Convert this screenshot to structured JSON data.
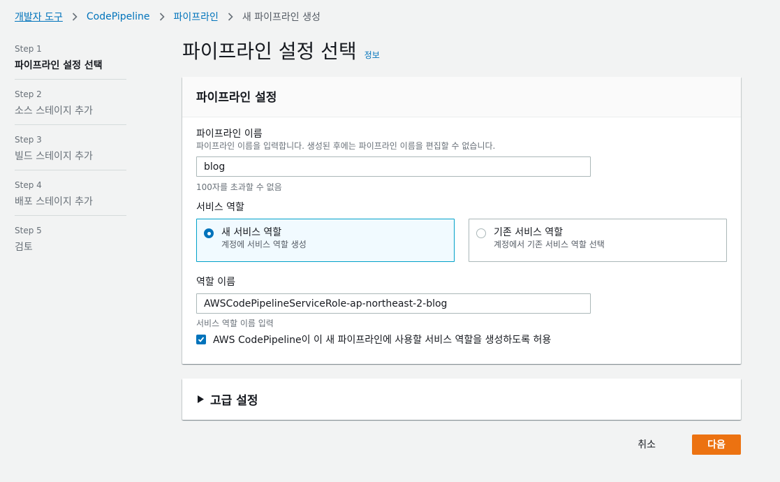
{
  "breadcrumb": {
    "items": [
      "개발자 도구",
      "CodePipeline",
      "파이프라인"
    ],
    "current": "새 파이프라인 생성"
  },
  "steps": [
    {
      "num": "Step 1",
      "label": "파이프라인 설정 선택",
      "active": true
    },
    {
      "num": "Step 2",
      "label": "소스 스테이지 추가",
      "active": false
    },
    {
      "num": "Step 3",
      "label": "빌드 스테이지 추가",
      "active": false
    },
    {
      "num": "Step 4",
      "label": "배포 스테이지 추가",
      "active": false
    },
    {
      "num": "Step 5",
      "label": "검토",
      "active": false
    }
  ],
  "page": {
    "title": "파이프라인 설정 선택",
    "info": "정보"
  },
  "settings": {
    "header": "파이프라인 설정",
    "name_label": "파이프라인 이름",
    "name_desc": "파이프라인 이름을 입력합니다. 생성된 후에는 파이프라인 이름을 편집할 수 없습니다.",
    "name_value": "blog",
    "name_constraint": "100자를 초과할 수 없음",
    "role_label": "서비스 역할",
    "new_role_title": "새 서비스 역할",
    "new_role_desc": "계정에 서비스 역할 생성",
    "existing_role_title": "기존 서비스 역할",
    "existing_role_desc": "계정에서 기존 서비스 역할 선택",
    "selected_role": "new",
    "role_name_label": "역할 이름",
    "role_name_value": "AWSCodePipelineServiceRole-ap-northeast-2-blog",
    "role_name_constraint": "서비스 역할 이름 입력",
    "allow_label": "AWS CodePipeline이 이 새 파이프라인에 사용할 서비스 역할을 생성하도록 허용",
    "allow_checked": true
  },
  "advanced": {
    "label": "고급 설정"
  },
  "actions": {
    "cancel": "취소",
    "next": "다음"
  },
  "colors": {
    "link": "#0073bb",
    "primary": "#ec7211",
    "selected_border": "#00a1c9",
    "selected_bg": "#f1faff"
  }
}
